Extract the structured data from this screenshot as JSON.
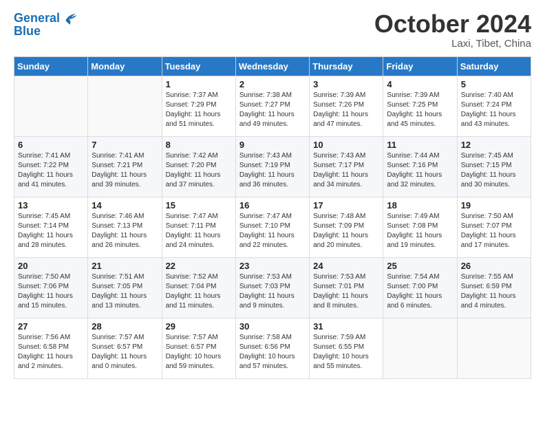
{
  "logo": {
    "line1": "General",
    "line2": "Blue"
  },
  "title": "October 2024",
  "subtitle": "Laxi, Tibet, China",
  "days_header": [
    "Sunday",
    "Monday",
    "Tuesday",
    "Wednesday",
    "Thursday",
    "Friday",
    "Saturday"
  ],
  "weeks": [
    [
      {
        "day": "",
        "sunrise": "",
        "sunset": "",
        "daylight": ""
      },
      {
        "day": "",
        "sunrise": "",
        "sunset": "",
        "daylight": ""
      },
      {
        "day": "1",
        "sunrise": "Sunrise: 7:37 AM",
        "sunset": "Sunset: 7:29 PM",
        "daylight": "Daylight: 11 hours and 51 minutes."
      },
      {
        "day": "2",
        "sunrise": "Sunrise: 7:38 AM",
        "sunset": "Sunset: 7:27 PM",
        "daylight": "Daylight: 11 hours and 49 minutes."
      },
      {
        "day": "3",
        "sunrise": "Sunrise: 7:39 AM",
        "sunset": "Sunset: 7:26 PM",
        "daylight": "Daylight: 11 hours and 47 minutes."
      },
      {
        "day": "4",
        "sunrise": "Sunrise: 7:39 AM",
        "sunset": "Sunset: 7:25 PM",
        "daylight": "Daylight: 11 hours and 45 minutes."
      },
      {
        "day": "5",
        "sunrise": "Sunrise: 7:40 AM",
        "sunset": "Sunset: 7:24 PM",
        "daylight": "Daylight: 11 hours and 43 minutes."
      }
    ],
    [
      {
        "day": "6",
        "sunrise": "Sunrise: 7:41 AM",
        "sunset": "Sunset: 7:22 PM",
        "daylight": "Daylight: 11 hours and 41 minutes."
      },
      {
        "day": "7",
        "sunrise": "Sunrise: 7:41 AM",
        "sunset": "Sunset: 7:21 PM",
        "daylight": "Daylight: 11 hours and 39 minutes."
      },
      {
        "day": "8",
        "sunrise": "Sunrise: 7:42 AM",
        "sunset": "Sunset: 7:20 PM",
        "daylight": "Daylight: 11 hours and 37 minutes."
      },
      {
        "day": "9",
        "sunrise": "Sunrise: 7:43 AM",
        "sunset": "Sunset: 7:19 PM",
        "daylight": "Daylight: 11 hours and 36 minutes."
      },
      {
        "day": "10",
        "sunrise": "Sunrise: 7:43 AM",
        "sunset": "Sunset: 7:17 PM",
        "daylight": "Daylight: 11 hours and 34 minutes."
      },
      {
        "day": "11",
        "sunrise": "Sunrise: 7:44 AM",
        "sunset": "Sunset: 7:16 PM",
        "daylight": "Daylight: 11 hours and 32 minutes."
      },
      {
        "day": "12",
        "sunrise": "Sunrise: 7:45 AM",
        "sunset": "Sunset: 7:15 PM",
        "daylight": "Daylight: 11 hours and 30 minutes."
      }
    ],
    [
      {
        "day": "13",
        "sunrise": "Sunrise: 7:45 AM",
        "sunset": "Sunset: 7:14 PM",
        "daylight": "Daylight: 11 hours and 28 minutes."
      },
      {
        "day": "14",
        "sunrise": "Sunrise: 7:46 AM",
        "sunset": "Sunset: 7:13 PM",
        "daylight": "Daylight: 11 hours and 26 minutes."
      },
      {
        "day": "15",
        "sunrise": "Sunrise: 7:47 AM",
        "sunset": "Sunset: 7:11 PM",
        "daylight": "Daylight: 11 hours and 24 minutes."
      },
      {
        "day": "16",
        "sunrise": "Sunrise: 7:47 AM",
        "sunset": "Sunset: 7:10 PM",
        "daylight": "Daylight: 11 hours and 22 minutes."
      },
      {
        "day": "17",
        "sunrise": "Sunrise: 7:48 AM",
        "sunset": "Sunset: 7:09 PM",
        "daylight": "Daylight: 11 hours and 20 minutes."
      },
      {
        "day": "18",
        "sunrise": "Sunrise: 7:49 AM",
        "sunset": "Sunset: 7:08 PM",
        "daylight": "Daylight: 11 hours and 19 minutes."
      },
      {
        "day": "19",
        "sunrise": "Sunrise: 7:50 AM",
        "sunset": "Sunset: 7:07 PM",
        "daylight": "Daylight: 11 hours and 17 minutes."
      }
    ],
    [
      {
        "day": "20",
        "sunrise": "Sunrise: 7:50 AM",
        "sunset": "Sunset: 7:06 PM",
        "daylight": "Daylight: 11 hours and 15 minutes."
      },
      {
        "day": "21",
        "sunrise": "Sunrise: 7:51 AM",
        "sunset": "Sunset: 7:05 PM",
        "daylight": "Daylight: 11 hours and 13 minutes."
      },
      {
        "day": "22",
        "sunrise": "Sunrise: 7:52 AM",
        "sunset": "Sunset: 7:04 PM",
        "daylight": "Daylight: 11 hours and 11 minutes."
      },
      {
        "day": "23",
        "sunrise": "Sunrise: 7:53 AM",
        "sunset": "Sunset: 7:03 PM",
        "daylight": "Daylight: 11 hours and 9 minutes."
      },
      {
        "day": "24",
        "sunrise": "Sunrise: 7:53 AM",
        "sunset": "Sunset: 7:01 PM",
        "daylight": "Daylight: 11 hours and 8 minutes."
      },
      {
        "day": "25",
        "sunrise": "Sunrise: 7:54 AM",
        "sunset": "Sunset: 7:00 PM",
        "daylight": "Daylight: 11 hours and 6 minutes."
      },
      {
        "day": "26",
        "sunrise": "Sunrise: 7:55 AM",
        "sunset": "Sunset: 6:59 PM",
        "daylight": "Daylight: 11 hours and 4 minutes."
      }
    ],
    [
      {
        "day": "27",
        "sunrise": "Sunrise: 7:56 AM",
        "sunset": "Sunset: 6:58 PM",
        "daylight": "Daylight: 11 hours and 2 minutes."
      },
      {
        "day": "28",
        "sunrise": "Sunrise: 7:57 AM",
        "sunset": "Sunset: 6:57 PM",
        "daylight": "Daylight: 11 hours and 0 minutes."
      },
      {
        "day": "29",
        "sunrise": "Sunrise: 7:57 AM",
        "sunset": "Sunset: 6:57 PM",
        "daylight": "Daylight: 10 hours and 59 minutes."
      },
      {
        "day": "30",
        "sunrise": "Sunrise: 7:58 AM",
        "sunset": "Sunset: 6:56 PM",
        "daylight": "Daylight: 10 hours and 57 minutes."
      },
      {
        "day": "31",
        "sunrise": "Sunrise: 7:59 AM",
        "sunset": "Sunset: 6:55 PM",
        "daylight": "Daylight: 10 hours and 55 minutes."
      },
      {
        "day": "",
        "sunrise": "",
        "sunset": "",
        "daylight": ""
      },
      {
        "day": "",
        "sunrise": "",
        "sunset": "",
        "daylight": ""
      }
    ]
  ]
}
